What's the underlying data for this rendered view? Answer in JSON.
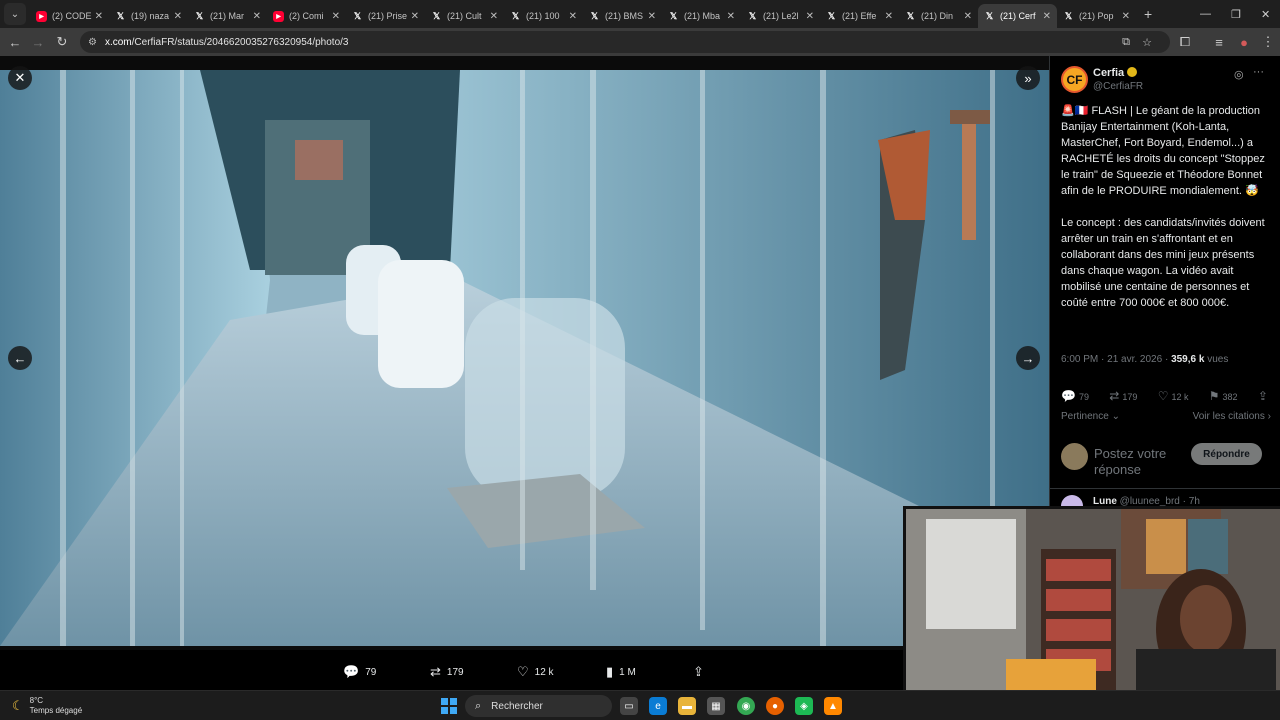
{
  "browser": {
    "tabs": [
      {
        "fav": "yt",
        "label": "(2) CODE"
      },
      {
        "fav": "x",
        "label": "(19) naza"
      },
      {
        "fav": "x",
        "label": "(21) Mar"
      },
      {
        "fav": "yt",
        "label": "(2) Comi"
      },
      {
        "fav": "x",
        "label": "(21) Prise"
      },
      {
        "fav": "x",
        "label": "(21) Cult"
      },
      {
        "fav": "x",
        "label": "(21) 100"
      },
      {
        "fav": "x",
        "label": "(21) BMS"
      },
      {
        "fav": "x",
        "label": "(21) Mba"
      },
      {
        "fav": "x",
        "label": "(21) Le2l"
      },
      {
        "fav": "x",
        "label": "(21) Effe"
      },
      {
        "fav": "x",
        "label": "(21) Din"
      },
      {
        "fav": "x",
        "label": "(21) Cerf",
        "active": true
      },
      {
        "fav": "x",
        "label": "(21) Pop"
      }
    ],
    "url_host": "x.com",
    "url_path": "/CerfiaFR/status/2046620035276320954/photo/3"
  },
  "viewer": {
    "close_icon": "close-icon",
    "collapse_icon": "chevrons-right-icon",
    "actions": {
      "replies": "79",
      "reposts": "179",
      "likes": "12 k",
      "views": "1 M"
    }
  },
  "tweet": {
    "author_name": "Cerfia",
    "author_handle": "@CerfiaFR",
    "avatar_text": "CF",
    "text": "🚨🇫🇷 FLASH | Le géant de la production Banijay Entertainment (Koh-Lanta, MasterChef, Fort Boyard, Endemol...) a RACHETÉ les droits du concept \"Stoppez le train\" de Squeezie et Théodore Bonnet afin de le PRODUIRE mondialement. 🤯\n\nLe concept : des candidats/invités doivent arrêter un train en s'affrontant et en collaborant dans des mini jeux présents dans chaque wagon. La vidéo avait mobilisé une centaine de personnes et coûté entre 700 000€ et 800 000€.",
    "time": "6:00 PM · 21 avr. 2026 · ",
    "views_count": "359,6 k",
    "views_label": " vues",
    "stats": {
      "replies": "79",
      "reposts": "179",
      "likes": "12 k",
      "bookmarks": "382"
    },
    "sort_label": "Pertinence",
    "quotes_label": "Voir les citations",
    "reply_placeholder": "Postez votre réponse",
    "reply_button": "Répondre",
    "next_reply_name": "Lune",
    "next_reply_meta": "@luunee_brd · 7h"
  },
  "taskbar": {
    "temp": "8°C",
    "weather": "Temps dégagé",
    "search": "Rechercher"
  }
}
